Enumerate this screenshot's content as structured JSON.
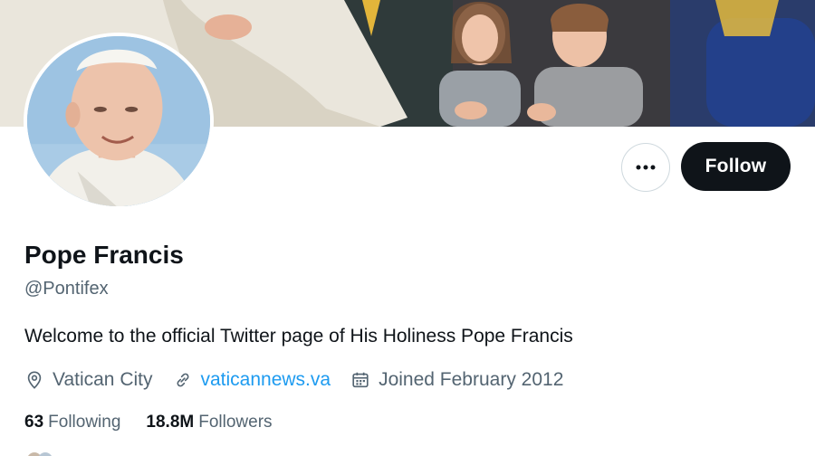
{
  "profile": {
    "name": "Pope Francis",
    "handle": "@Pontifex",
    "bio": "Welcome to the official Twitter page of His Holiness Pope Francis",
    "location": "Vatican City",
    "website": "vaticannews.va",
    "joined": "Joined February 2012"
  },
  "actions": {
    "follow_label": "Follow"
  },
  "stats": {
    "following_count": "63",
    "following_label": "Following",
    "followers_count": "18.8M",
    "followers_label": "Followers"
  },
  "icons": {
    "location": "map-pin-icon",
    "website": "link-icon",
    "joined": "calendar-icon",
    "more": "more-horizontal-icon"
  },
  "colors": {
    "text_primary": "#0f1419",
    "text_secondary": "#536471",
    "link": "#1d9bf0",
    "follow_button_bg": "#0f1419",
    "follow_button_text": "#ffffff"
  }
}
